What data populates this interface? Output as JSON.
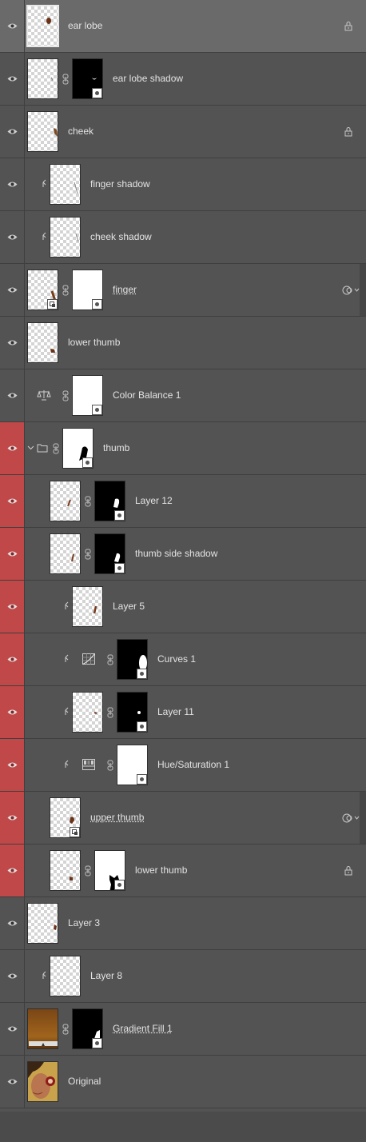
{
  "layers": [
    {
      "name": "ear lobe",
      "selected": true,
      "locked": true
    },
    {
      "name": "ear lobe shadow",
      "mask": "black"
    },
    {
      "name": "cheek",
      "locked": true
    },
    {
      "name": "finger shadow",
      "clipped": true
    },
    {
      "name": "cheek shadow",
      "clipped": true
    },
    {
      "name": "finger",
      "smart_object": true,
      "mask": "white"
    },
    {
      "name": "lower thumb"
    },
    {
      "name": "Color Balance 1",
      "adjustment": "color-balance",
      "mask": "white"
    },
    {
      "name": "thumb",
      "group": true,
      "mask": "white",
      "in_group": true
    },
    {
      "name": "Layer 12",
      "mask": "black",
      "in_group": true
    },
    {
      "name": "thumb side shadow",
      "mask": "black",
      "in_group": true
    },
    {
      "name": "Layer 5",
      "clipped": true,
      "in_group": true
    },
    {
      "name": "Curves 1",
      "adjustment": "curves",
      "mask": "black",
      "clipped": true,
      "in_group": true
    },
    {
      "name": "Layer 11",
      "mask": "black",
      "clipped": true,
      "in_group": true
    },
    {
      "name": "Hue/Saturation 1",
      "adjustment": "hue-saturation",
      "mask": "white",
      "clipped": true,
      "in_group": true
    },
    {
      "name": "upper thumb",
      "smart_object": true,
      "in_group": true
    },
    {
      "name": "lower thumb",
      "mask": "white",
      "locked": true,
      "in_group": true
    },
    {
      "name": "Layer 3"
    },
    {
      "name": "Layer 8",
      "clipped": true
    },
    {
      "name": "Gradient Fill 1",
      "gradient": true,
      "mask": "black"
    },
    {
      "name": "Original",
      "photo": true
    }
  ],
  "colors": {
    "panel_bg": "#535353",
    "selected_bg": "#6a6a6a",
    "group_highlight": "#c04848"
  }
}
